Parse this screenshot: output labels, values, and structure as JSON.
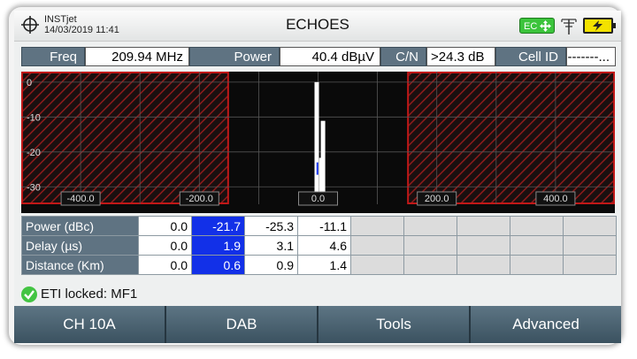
{
  "header": {
    "brand": "INSTjet",
    "datetime": "14/03/2019 11:41",
    "title": "ECHOES",
    "ec_badge": "EC"
  },
  "info_bar": {
    "freq_label": "Freq",
    "freq_value": "209.94 MHz",
    "power_label": "Power",
    "power_value": "40.4 dBµV",
    "cn_label": "C/N",
    "cn_value": ">24.3 dB",
    "cellid_label": "Cell ID",
    "cellid_value": "-------..."
  },
  "chart_data": {
    "type": "bar",
    "xlim": [
      -500,
      500
    ],
    "ylim": [
      -35,
      3
    ],
    "y_ticks": [
      "0",
      "-10",
      "-20",
      "-30"
    ],
    "x_ticks": [
      "-400.0",
      "-200.0",
      "0.0",
      "200.0",
      "400.0"
    ],
    "grid": true,
    "excluded_zones": [
      [
        -500,
        -150
      ],
      [
        150,
        500
      ]
    ],
    "bars": [
      {
        "x": 0.0,
        "y": 0.0
      },
      {
        "x": 1.9,
        "y": -21.7
      },
      {
        "x": 3.1,
        "y": -25.3
      },
      {
        "x": 4.6,
        "y": -11.1
      }
    ],
    "colors": {
      "bar": "#ffffff",
      "marker": "#1230e8",
      "zone": "#c01818",
      "grid": "#555555"
    }
  },
  "table": {
    "rows": [
      {
        "label": "Power (dBc)",
        "values": [
          "0.0",
          "-21.7",
          "-25.3",
          "-11.1"
        ]
      },
      {
        "label": "Delay (µs)",
        "values": [
          "0.0",
          "1.9",
          "3.1",
          "4.6"
        ]
      },
      {
        "label": "Distance (Km)",
        "values": [
          "0.0",
          "0.6",
          "0.9",
          "1.4"
        ]
      }
    ],
    "selected_column": 1,
    "empty_columns": 5
  },
  "status": {
    "text": "ETI locked: MF1",
    "icon": "check-icon"
  },
  "buttons": [
    "CH 10A",
    "DAB",
    "Tools",
    "Advanced"
  ]
}
